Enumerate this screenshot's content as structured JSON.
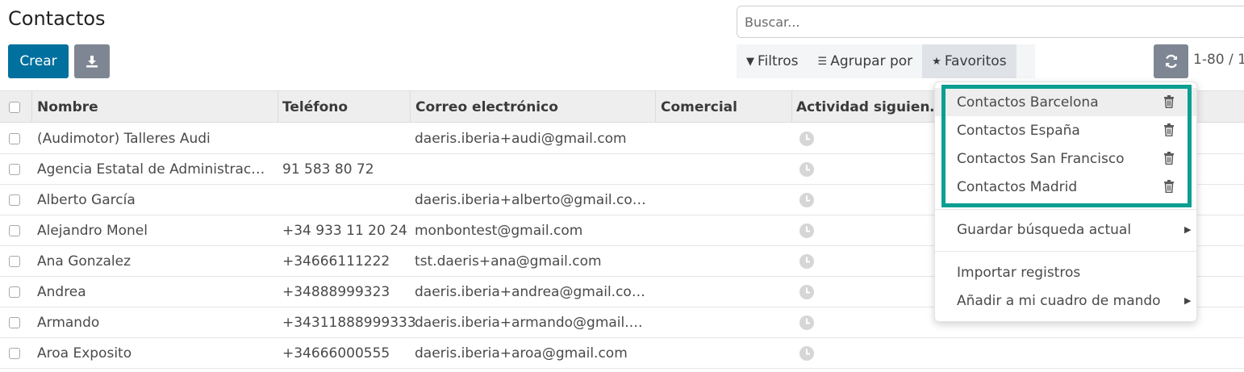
{
  "page": {
    "title": "Contactos"
  },
  "toolbar": {
    "create_label": "Crear",
    "download_icon": "download-icon"
  },
  "search": {
    "placeholder": "Buscar..."
  },
  "filters": {
    "filters_label": "Filtros",
    "group_by_label": "Agrupar por",
    "favorites_label": "Favoritos"
  },
  "pager": {
    "text": "1-80 / 1"
  },
  "table": {
    "columns": [
      "Nombre",
      "Teléfono",
      "Correo electrónico",
      "Comercial",
      "Actividad siguien…"
    ],
    "rows": [
      {
        "name": "(Audimotor) Talleres Audi",
        "phone": "",
        "email": "daeris.iberia+audi@gmail.com"
      },
      {
        "name": "Agencia Estatal de Administrac…",
        "phone": "91 583 80 72",
        "email": ""
      },
      {
        "name": "Alberto García",
        "phone": "",
        "email": "daeris.iberia+alberto@gmail.co…"
      },
      {
        "name": "Alejandro Monel",
        "phone": "+34 933 11 20 24",
        "email": "monbontest@gmail.com"
      },
      {
        "name": "Ana Gonzalez",
        "phone": "+34666111222",
        "email": "tst.daeris+ana@gmail.com"
      },
      {
        "name": "Andrea",
        "phone": "+34888999323",
        "email": "daeris.iberia+andrea@gmail.co…"
      },
      {
        "name": "Armando",
        "phone": "+34311888999333",
        "email": "daeris.iberia+armando@gmail.…"
      },
      {
        "name": "Aroa Exposito",
        "phone": "+34666000555",
        "email": "daeris.iberia+aroa@gmail.com"
      }
    ]
  },
  "favorites_menu": {
    "saved": [
      "Contactos Barcelona",
      "Contactos España",
      "Contactos San Francisco",
      "Contactos Madrid"
    ],
    "save_current": "Guardar búsqueda actual",
    "import_records": "Importar registros",
    "add_dashboard": "Añadir a mi cuadro de mando"
  },
  "colors": {
    "primary": "#00709e",
    "secondary": "#7f8693",
    "highlight": "#0a9f92"
  }
}
